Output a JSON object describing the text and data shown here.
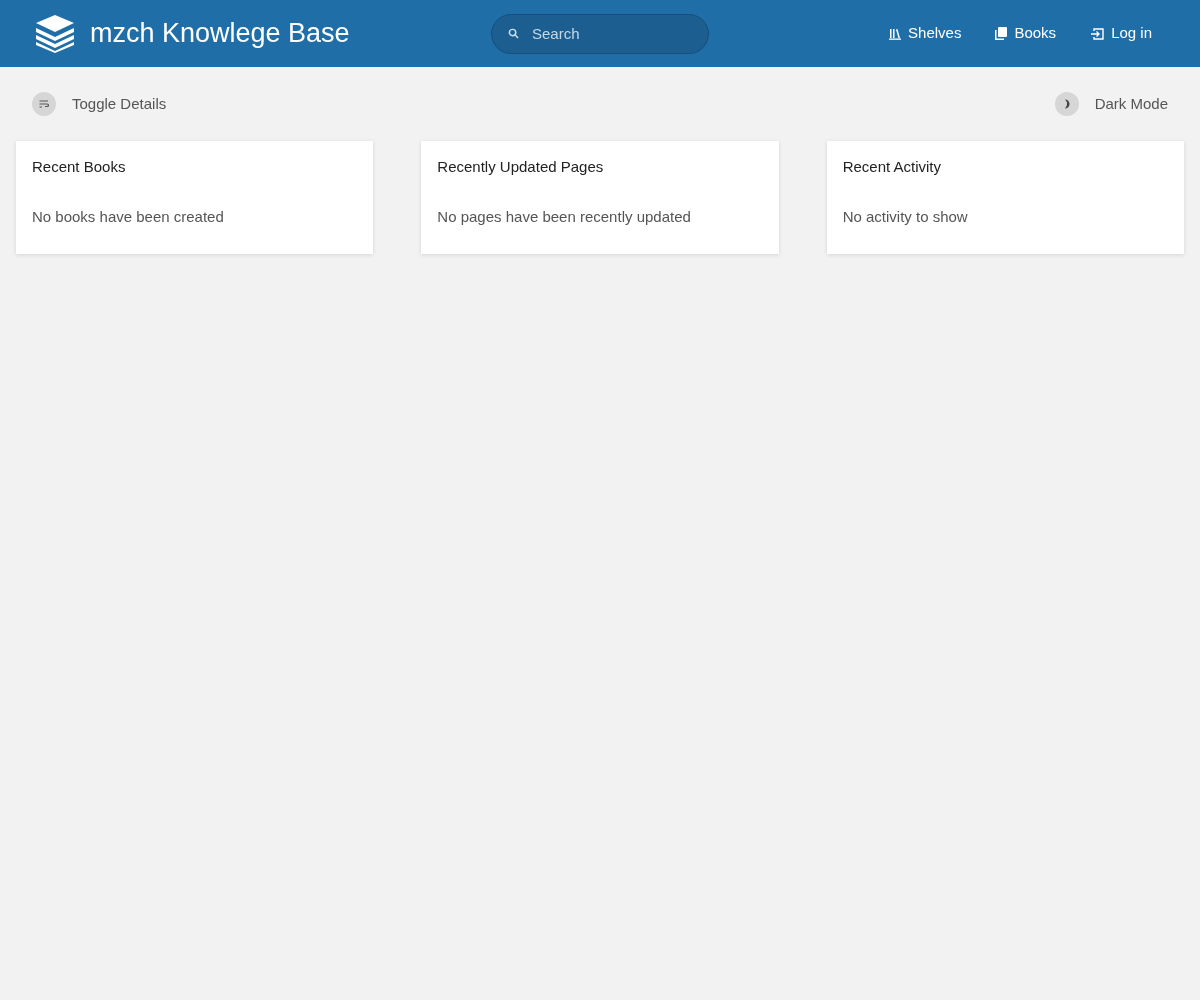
{
  "header": {
    "title": "mzch Knowlege Base",
    "search": {
      "placeholder": "Search"
    },
    "nav": [
      {
        "kind": "shelves",
        "label": "Shelves"
      },
      {
        "kind": "books",
        "label": "Books"
      },
      {
        "kind": "login",
        "label": "Log in"
      }
    ]
  },
  "toolbar": {
    "left": {
      "kind": "details",
      "label": "Toggle Details"
    },
    "right": {
      "kind": "dark",
      "label": "Dark Mode"
    }
  },
  "cards": [
    {
      "title": "Recent Books",
      "empty": "No books have been created"
    },
    {
      "title": "Recently Updated Pages",
      "empty": "No pages have been recently updated"
    },
    {
      "title": "Recent Activity",
      "empty": "No activity to show"
    }
  ]
}
